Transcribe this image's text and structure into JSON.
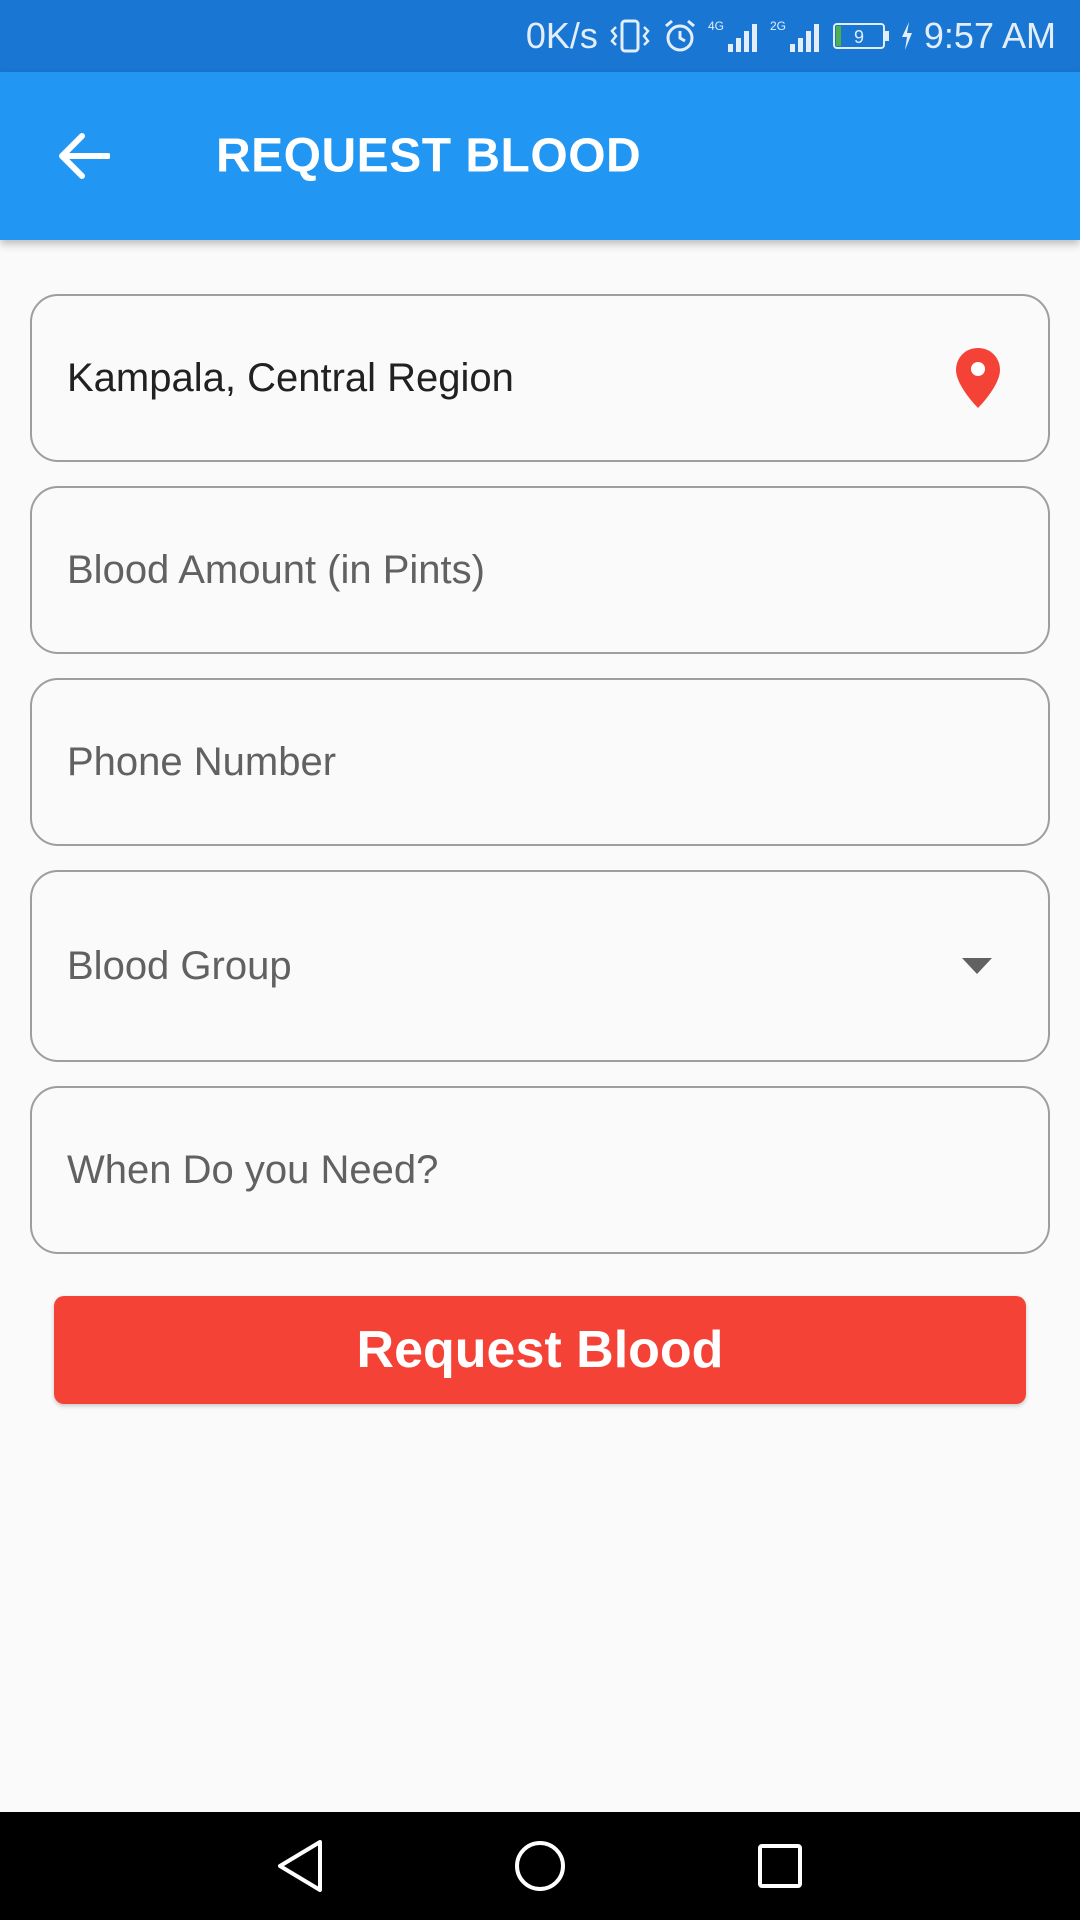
{
  "status_bar": {
    "net_speed": "0K/s",
    "network_1": "4G",
    "network_2": "2G",
    "battery_level": "9",
    "time": "9:57 AM",
    "icons": [
      "vibrate-icon",
      "alarm-icon",
      "signal-4g-icon",
      "signal-2g-icon",
      "battery-icon",
      "charging-icon"
    ]
  },
  "app_bar": {
    "title": "REQUEST BLOOD",
    "back_icon": "arrow-back-icon"
  },
  "form": {
    "location": {
      "value": "Kampala, Central Region",
      "icon": "location-pin-icon"
    },
    "blood_amount": {
      "placeholder": "Blood Amount (in Pints)",
      "value": ""
    },
    "phone_number": {
      "placeholder": "Phone Number",
      "value": ""
    },
    "blood_group": {
      "placeholder": "Blood Group",
      "icon": "dropdown-arrow-icon"
    },
    "when_needed": {
      "placeholder": "When Do you Need?",
      "value": ""
    },
    "submit_label": "Request Blood"
  },
  "nav_bar": {
    "icons": [
      "nav-back-icon",
      "nav-home-icon",
      "nav-recents-icon"
    ]
  },
  "colors": {
    "status_bar": "#1976d2",
    "app_bar": "#2196f3",
    "accent_red": "#f44336",
    "field_border": "#9e9e9e",
    "background": "#fafafa"
  }
}
